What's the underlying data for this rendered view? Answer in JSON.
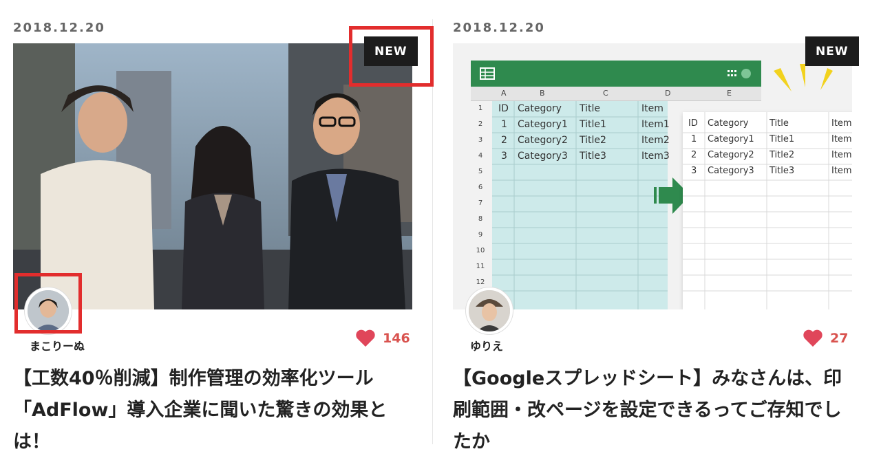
{
  "cards": [
    {
      "date": "2018.12.20",
      "badge": "NEW",
      "author": "まこりーぬ",
      "likes": "146",
      "title": "【工数40％削減】制作管理の効率化ツール「AdFlow」導入企業に聞いた驚きの効果とは！"
    },
    {
      "date": "2018.12.20",
      "badge": "NEW",
      "author": "ゆりえ",
      "likes": "27",
      "title": "【Googleスプレッドシート】みなさんは、印刷範囲・改ページを設定できるってご存知でしたか",
      "sheet": {
        "columns": [
          "A",
          "B",
          "C",
          "D",
          "E"
        ],
        "rows": [
          "1",
          "2",
          "3",
          "4",
          "5",
          "6",
          "7",
          "8",
          "9",
          "10",
          "11",
          "12"
        ],
        "header": [
          "ID",
          "Category",
          "Title",
          "Item"
        ],
        "data": [
          [
            "1",
            "Category1",
            "Title1",
            "Item1"
          ],
          [
            "2",
            "Category2",
            "Title2",
            "Item2"
          ],
          [
            "3",
            "Category3",
            "Title3",
            "Item3"
          ]
        ]
      }
    }
  ],
  "colors": {
    "heart": "#e0465a",
    "sheet_green": "#2f8a4e",
    "highlight": "#e22d2d"
  }
}
